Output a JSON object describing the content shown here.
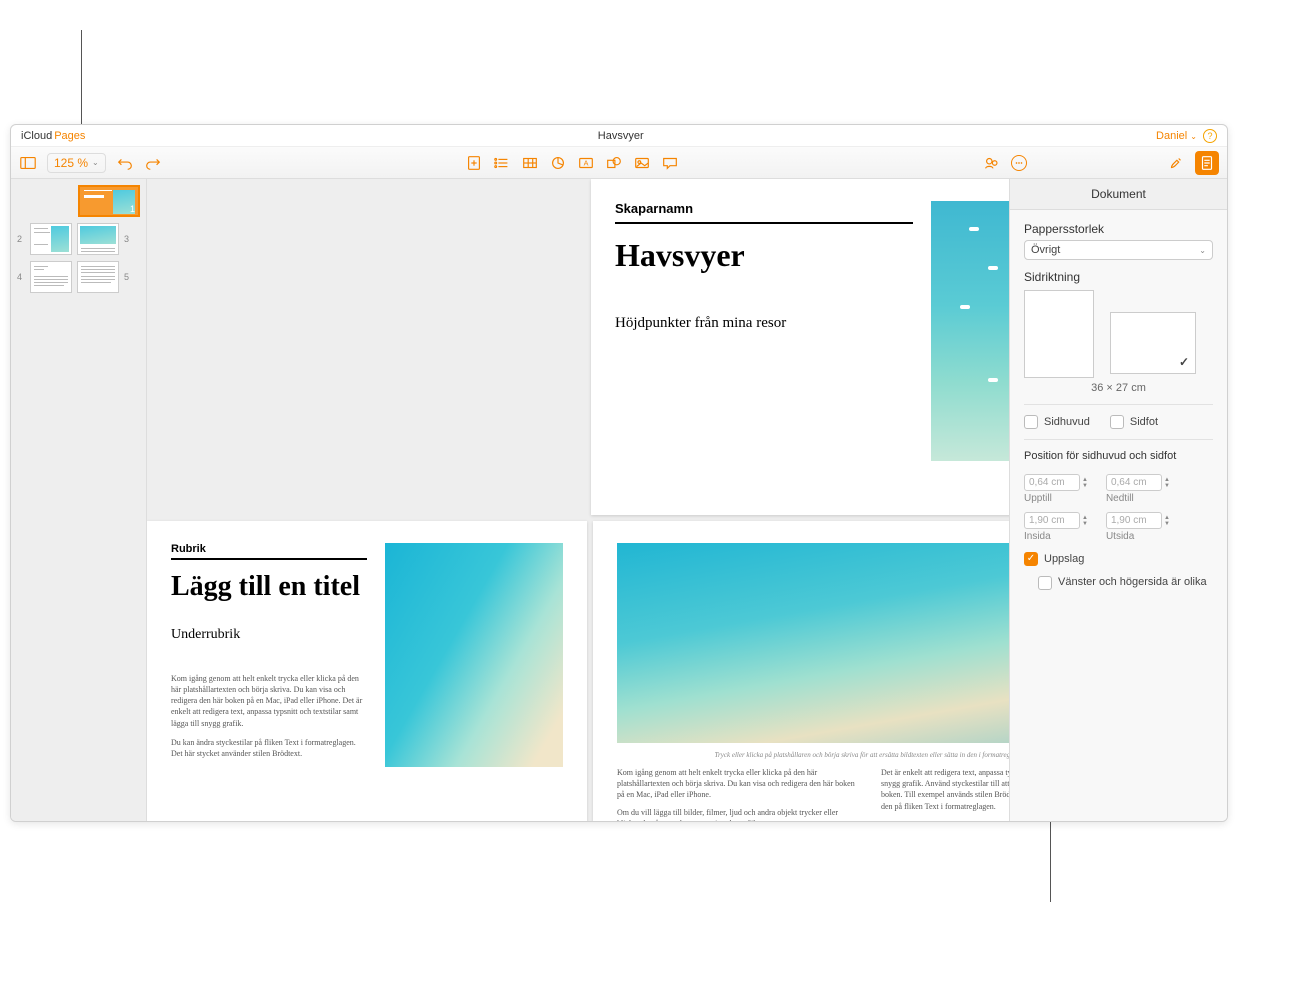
{
  "titlebar": {
    "icloud": "iCloud",
    "pages": "Pages",
    "doc_title": "Havsvyer",
    "user": "Daniel"
  },
  "toolbar": {
    "zoom": "125 %"
  },
  "thumbnails": {
    "n1": "1",
    "n2": "2",
    "n3": "3",
    "n4": "4",
    "n5": "5"
  },
  "page1": {
    "creator": "Skaparnamn",
    "title": "Havsvyer",
    "subtitle": "Höjdpunkter från mina resor"
  },
  "page2": {
    "rubrik": "Rubrik",
    "title": "Lägg till en titel",
    "sub": "Underrubrik",
    "body1": "Kom igång genom att helt enkelt trycka eller klicka på den här platshållartexten och börja skriva. Du kan visa och redigera den här boken på en Mac, iPad eller iPhone. Det är enkelt att redigera text, anpassa typsnitt och textstilar samt lägga till snygg grafik.",
    "body2": "Du kan ändra styckestilar på fliken Text i formatreglagen. Det här stycket använder stilen Brödtext."
  },
  "page3": {
    "caption": "Tryck eller klicka på platshållaren och börja skriva för att ersätta bildtexten eller sätta in den i formatreglagen.",
    "col1a": "Kom igång genom att helt enkelt trycka eller klicka på den här platshållartexten och börja skriva. Du kan visa och redigera den här boken på en Mac, iPad eller iPhone.",
    "col1b": "Om du vill lägga till bilder, filmer, ljud och andra objekt trycker eller klickar du på en av knapparna i verktygsfältet",
    "col2a": "Det är enkelt att redigera text, anpassa typsnitt och textstilar samt lägga till snygg grafik. Använd styckestilar till att skapa ett enhetligt utseende i hela boken. Till exempel används stilen Brödtext i det här stycket. Du kan ändra den på fliken Text i formatreglagen."
  },
  "inspector": {
    "tab": "Dokument",
    "paper_label": "Pappersstorlek",
    "paper_value": "Övrigt",
    "orient_label": "Sidriktning",
    "orient_size": "36 × 27 cm",
    "header_label": "Sidhuvud",
    "footer_label": "Sidfot",
    "pos_label": "Position för sidhuvud och sidfot",
    "upptill": "Upptill",
    "nedtill": "Nedtill",
    "insida": "Insida",
    "utsida": "Utsida",
    "val_top": "0,64 cm",
    "val_bottom": "0,64 cm",
    "val_inside": "1,90 cm",
    "val_outside": "1,90 cm",
    "spread": "Uppslag",
    "diff_lr": "Vänster och högersida är olika"
  }
}
